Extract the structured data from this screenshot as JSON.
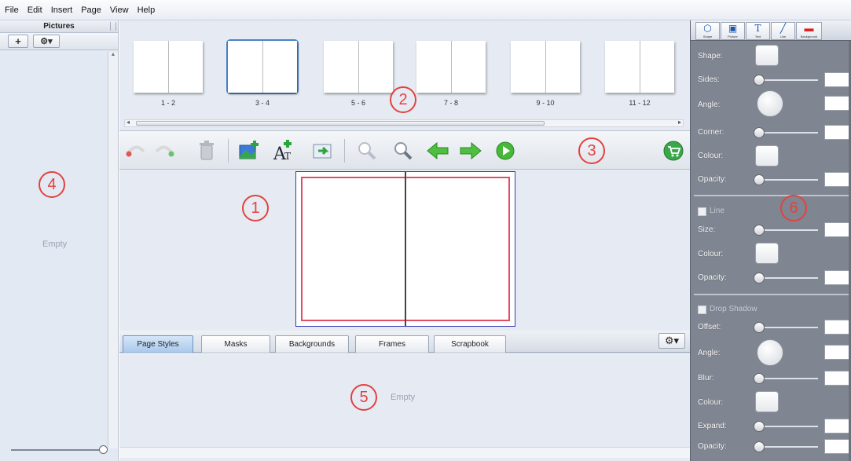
{
  "menu": [
    "File",
    "Edit",
    "Insert",
    "Page",
    "View",
    "Help"
  ],
  "pictures_panel": {
    "title": "Pictures",
    "add_label": "+",
    "gear_label": "⚙▾",
    "empty_text": "Empty"
  },
  "thumbnails": [
    {
      "label": "1 - 2",
      "selected": false
    },
    {
      "label": "3 - 4",
      "selected": true
    },
    {
      "label": "5 - 6",
      "selected": false
    },
    {
      "label": "7 - 8",
      "selected": false
    },
    {
      "label": "9 - 10",
      "selected": false
    },
    {
      "label": "11 - 12",
      "selected": false
    }
  ],
  "toolbar_icons": [
    "undo-icon",
    "redo-icon",
    "trash-icon",
    "add-picture-icon",
    "add-text-icon",
    "export-icon",
    "zoom-out-icon",
    "zoom-in-icon",
    "prev-page-icon",
    "next-page-icon",
    "play-icon",
    "shop-cart-icon"
  ],
  "tabs": [
    {
      "label": "Page Styles",
      "active": true
    },
    {
      "label": "Masks",
      "active": false
    },
    {
      "label": "Backgrounds",
      "active": false
    },
    {
      "label": "Frames",
      "active": false
    },
    {
      "label": "Scrapbook",
      "active": false
    }
  ],
  "bottom_panel": {
    "empty_text": "Empty"
  },
  "callouts": [
    "1",
    "2",
    "3",
    "4",
    "5",
    "6"
  ],
  "properties": {
    "tabs": [
      "Shape",
      "Picture",
      "Text",
      "Line",
      "Background"
    ],
    "shape_section": [
      {
        "label": "Shape:",
        "control": "swatch"
      },
      {
        "label": "Sides:",
        "control": "slider"
      },
      {
        "label": "Angle:",
        "control": "dial"
      },
      {
        "label": "Corner:",
        "control": "slider"
      },
      {
        "label": "Colour:",
        "control": "swatch"
      },
      {
        "label": "Opacity:",
        "control": "slider"
      }
    ],
    "line_section": {
      "toggle_label": "Line",
      "rows": [
        {
          "label": "Size:",
          "control": "slider"
        },
        {
          "label": "Colour:",
          "control": "swatch"
        },
        {
          "label": "Opacity:",
          "control": "slider"
        }
      ]
    },
    "shadow_section": {
      "toggle_label": "Drop Shadow",
      "rows": [
        {
          "label": "Offset:",
          "control": "slider"
        },
        {
          "label": "Angle:",
          "control": "dial"
        },
        {
          "label": "Blur:",
          "control": "slider"
        },
        {
          "label": "Colour:",
          "control": "swatch"
        },
        {
          "label": "Expand:",
          "control": "slider"
        },
        {
          "label": "Opacity:",
          "control": "slider"
        }
      ]
    }
  },
  "colors": {
    "callout": "#e3423f",
    "accent": "#4a85c9",
    "spread_border": "#e24d66"
  }
}
